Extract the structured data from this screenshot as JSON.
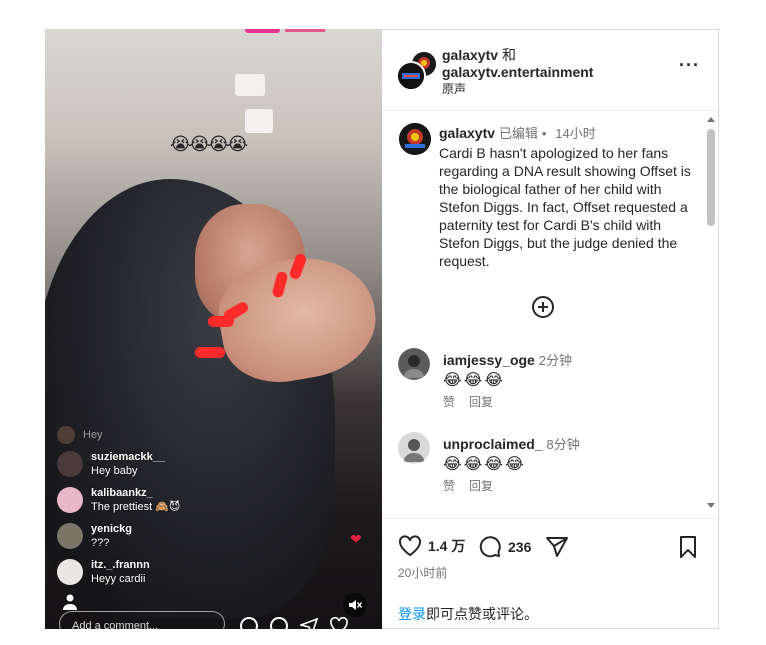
{
  "video": {
    "emoji_overlay": "😭😭😭😭",
    "live_comments": [
      {
        "user": "",
        "text": "Hey",
        "avatar_color": "#7a5a48",
        "faded": true
      },
      {
        "user": "suziemackk__",
        "text": "Hey baby",
        "avatar_color": "#4a3a38",
        "faded": false
      },
      {
        "user": "kalibaankz_",
        "text": "The prettiest 🙈😈",
        "avatar_color": "#e8b7c8",
        "faded": false
      },
      {
        "user": "yenickg",
        "text": "???",
        "avatar_color": "#7d7468",
        "faded": false
      },
      {
        "user": "itz._.frannn",
        "text": "Heyy cardii",
        "avatar_color": "#e9e6e3",
        "faded": false
      }
    ],
    "comment_placeholder": "Add a comment..."
  },
  "header": {
    "account1": "galaxytv",
    "joiner": "和",
    "account2": "galaxytv.entertainment",
    "audio": "原声",
    "more_label": "···"
  },
  "caption": {
    "user": "galaxytv",
    "edited": "已编辑",
    "dot": "•",
    "time": "14小时",
    "text": "Cardi B hasn't apologized to her fans regarding a DNA result showing Offset is the biological father of her child with Stefon Diggs. In fact, Offset requested a paternity test for Cardi B's child with Stefon Diggs, but the judge denied the request."
  },
  "comments": [
    {
      "user": "iamjessy_oge",
      "time": "2分钟",
      "text": "😂😂😂",
      "like": "赞",
      "reply": "回复",
      "avatar_color": "#5b5b5b"
    },
    {
      "user": "unproclaimed_",
      "time": "8分钟",
      "text": "😂😂😂😂",
      "like": "赞",
      "reply": "回复",
      "avatar_color": "#c8c8c8"
    }
  ],
  "footer": {
    "likes": "1.4 万",
    "comments_count": "236",
    "time_ago": "20小时前",
    "login_link": "登录",
    "login_rest": "即可点赞或评论。"
  }
}
